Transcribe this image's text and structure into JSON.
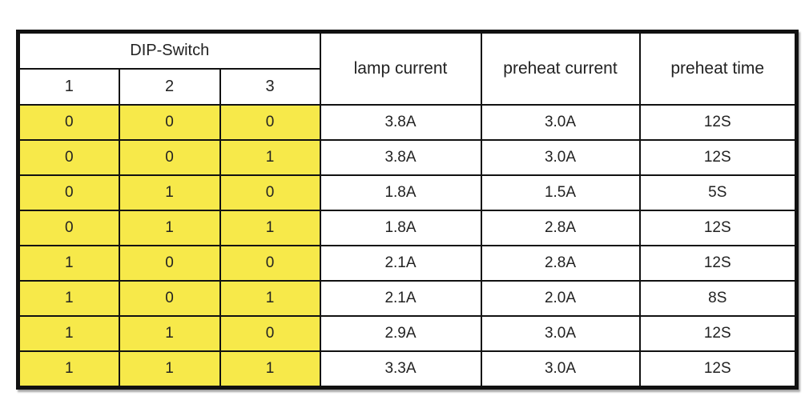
{
  "table": {
    "group_header": "DIP-Switch",
    "switch_headers": [
      "1",
      "2",
      "3"
    ],
    "value_headers": [
      "lamp current",
      "preheat current",
      "preheat time"
    ],
    "colors": {
      "switch_fill": "#f7e94a",
      "border": "#111111"
    },
    "rows": [
      {
        "switches": [
          "0",
          "0",
          "0"
        ],
        "lamp_current": "3.8A",
        "preheat_current": "3.0A",
        "preheat_time": "12S"
      },
      {
        "switches": [
          "0",
          "0",
          "1"
        ],
        "lamp_current": "3.8A",
        "preheat_current": "3.0A",
        "preheat_time": "12S"
      },
      {
        "switches": [
          "0",
          "1",
          "0"
        ],
        "lamp_current": "1.8A",
        "preheat_current": "1.5A",
        "preheat_time": "5S"
      },
      {
        "switches": [
          "0",
          "1",
          "1"
        ],
        "lamp_current": "1.8A",
        "preheat_current": "2.8A",
        "preheat_time": "12S"
      },
      {
        "switches": [
          "1",
          "0",
          "0"
        ],
        "lamp_current": "2.1A",
        "preheat_current": "2.8A",
        "preheat_time": "12S"
      },
      {
        "switches": [
          "1",
          "0",
          "1"
        ],
        "lamp_current": "2.1A",
        "preheat_current": "2.0A",
        "preheat_time": "8S"
      },
      {
        "switches": [
          "1",
          "1",
          "0"
        ],
        "lamp_current": "2.9A",
        "preheat_current": "3.0A",
        "preheat_time": "12S"
      },
      {
        "switches": [
          "1",
          "1",
          "1"
        ],
        "lamp_current": "3.3A",
        "preheat_current": "3.0A",
        "preheat_time": "12S"
      }
    ]
  }
}
